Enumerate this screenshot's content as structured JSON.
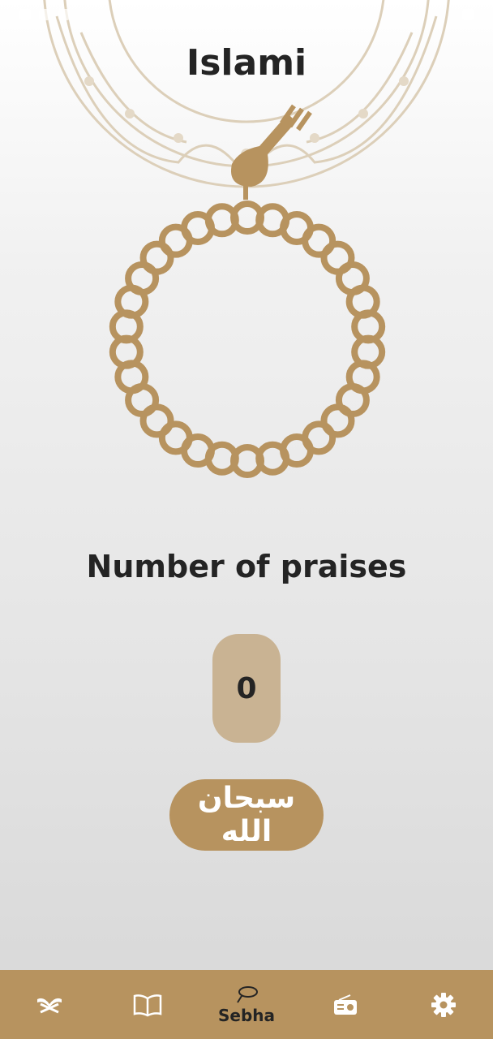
{
  "app": {
    "title": "Islami"
  },
  "sebha": {
    "label": "Number of praises",
    "count": "0",
    "dhikr": "سبحان الله"
  },
  "bottom_nav": {
    "items": [
      {
        "name": "quran",
        "icon": "quran-stand-icon",
        "label": ""
      },
      {
        "name": "hadith",
        "icon": "open-book-icon",
        "label": ""
      },
      {
        "name": "sebha",
        "icon": "sebha-icon",
        "label": "Sebha",
        "selected": true
      },
      {
        "name": "radio",
        "icon": "radio-icon",
        "label": ""
      },
      {
        "name": "settings",
        "icon": "gear-icon",
        "label": ""
      }
    ]
  },
  "colors": {
    "accent": "#b7935f",
    "counter_bg": "#c9b393",
    "text": "#242424"
  }
}
